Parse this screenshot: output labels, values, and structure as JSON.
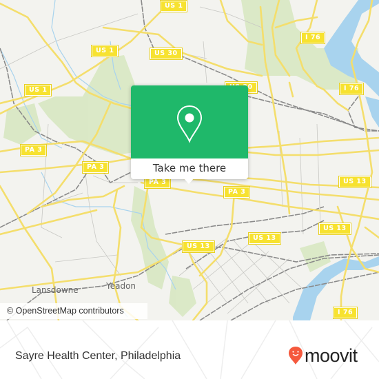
{
  "map": {
    "attribution": "© OpenStreetMap contributors",
    "shields": [
      {
        "label": "US 1"
      },
      {
        "label": "US 1"
      },
      {
        "label": "US 30"
      },
      {
        "label": "US 1"
      },
      {
        "label": "PA 3"
      },
      {
        "label": "PA 3"
      },
      {
        "label": "US 30"
      },
      {
        "label": "I 76"
      },
      {
        "label": "I 76"
      },
      {
        "label": "US 13"
      },
      {
        "label": "PA 3"
      },
      {
        "label": "US 13"
      },
      {
        "label": "US 13"
      },
      {
        "label": "US 13"
      },
      {
        "label": "I 76"
      },
      {
        "label": "PA 3"
      }
    ],
    "places": [
      {
        "label": "Lansdowne"
      },
      {
        "label": "Yeadon"
      }
    ]
  },
  "popup": {
    "icon": "location-pin-icon",
    "button_label": "Take me there",
    "color": "#1fb86a"
  },
  "footer": {
    "location_title": "Sayre Health Center, Philadelphia",
    "brand": "moovit",
    "brand_color": "#f5593d"
  }
}
